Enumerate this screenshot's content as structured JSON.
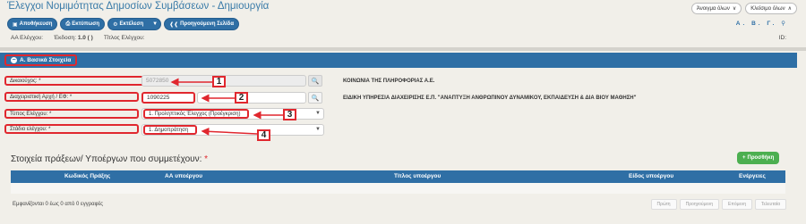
{
  "header": {
    "title": "Έλεγχοι Νομιμότητας Δημοσίων Συμβάσεων - Δημιουργία",
    "toolbar": {
      "save": "Αποθήκευση",
      "print": "Εκτύπωση",
      "execute": "Εκτέλεση",
      "previous": "Προηγούμενη Σελίδα"
    },
    "open_all": "Άνοιγμα όλων",
    "close_all": "Κλείσιμο όλων",
    "font_letters": "Α. Β. Γ.",
    "meta": {
      "aa_label": "ΑΑ Ελέγχου:",
      "version_label": "Έκδοση:",
      "version_value": "1.0 ( )",
      "title_label": "Τίτλος Ελέγχου:",
      "id_label": "ID:"
    }
  },
  "section": {
    "title": "Α. Βασικά Στοιχεία"
  },
  "fields": {
    "beneficiary_label": "Δικαιούχος: *",
    "beneficiary_code": "5072850",
    "beneficiary_name": "ΚΟΙΝΩΝΙΑ ΤΗΣ ΠΛΗΡΟΦΟΡΙΑΣ Α.Ε.",
    "authority_label": "Διαχειριστική Αρχή / ΕΦ: *",
    "authority_code": "1090225",
    "authority_name": "ΕΙΔΙΚΗ ΥΠΗΡΕΣΙΑ ΔΙΑΧΕΙΡΙΣΗΣ Ε.Π. \"ΑΝΑΠΤΥΞΗ ΑΝΘΡΩΠΙΝΟΥ ΔΥΝΑΜΙΚΟΥ, ΕΚΠΑΙΔΕΥΣΗ & ΔΙΑ ΒΙΟΥ ΜΑΘΗΣΗ\"",
    "check_type_label": "Τύπος Ελέγχου: *",
    "check_type_value": "1. Προληπτικός Έλεγχος (Προέγκριση)",
    "stage_label": "Στάδιο ελέγχου: *",
    "stage_value": "1. Δημοπράτηση"
  },
  "callouts": [
    "1",
    "2",
    "3",
    "4"
  ],
  "subprojects": {
    "title": "Στοιχεία πράξεων/ Υποέργων που συμμετέχουν:",
    "required_mark": "*",
    "add_button": "Προσθήκη",
    "columns": [
      "Κωδικός Πράξης",
      "ΑΑ υποέργου",
      "Τίτλος υποέργου",
      "Είδος υποέργου",
      "Ενέργειες"
    ],
    "empty_info": "Εμφανίζονται 0 έως 0 από 0 εγγραφές",
    "pager": [
      "Πρώτη",
      "Προηγούμενη",
      "Επόμενη",
      "Τελευταία"
    ]
  },
  "colors": {
    "primary": "#2f6fa5",
    "highlight": "#e0272e",
    "add": "#4caf50",
    "background": "#f1efe9"
  }
}
